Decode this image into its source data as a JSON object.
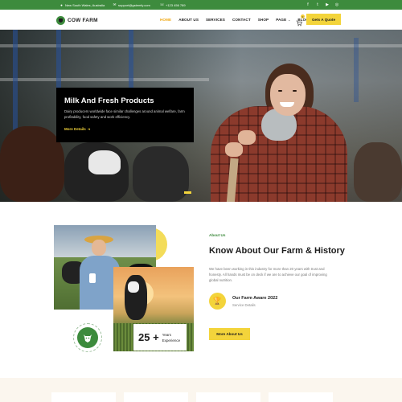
{
  "topbar": {
    "location": "New South Wales, Australia",
    "email": "support@gstemfy.com",
    "phone": "+123 456 789",
    "socials": [
      "facebook-icon",
      "twitter-icon",
      "youtube-icon",
      "instagram-icon"
    ]
  },
  "nav": {
    "logo": "COW FARM",
    "items": [
      "HOME",
      "ABOUT US",
      "SERVICES",
      "CONTACT",
      "SHOP",
      "PAGE",
      "BLOG"
    ],
    "cart_count": "0",
    "quote": "Gets A Quote"
  },
  "hero": {
    "title": "Milk And Fresh Products",
    "description": "Dairy producers worldwide face similar challenges around animal welfare, farm profitability, food safety and work efficiency.",
    "link": "More Details"
  },
  "about": {
    "kicker": "About Us",
    "title": "Know About Our Farm & History",
    "description": "We have been working in this industry for more than 20 years with trust and honesty. All hands must be on deck if we are to achieve our goal of improving global nutrition.",
    "award_title": "Our Farm Aware 2022",
    "award_sub": "Service Details",
    "button": "More About Us",
    "experience_number": "25 +",
    "experience_label_1": "Years",
    "experience_label_2": "Experience"
  },
  "colors": {
    "brand_green": "#3d8b3d",
    "accent_yellow": "#f3d43b",
    "active_orange": "#f0a813"
  }
}
